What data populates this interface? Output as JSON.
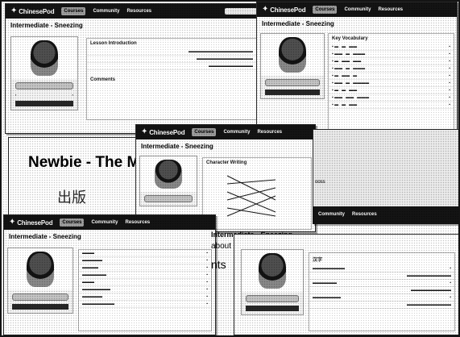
{
  "brand": "ChinesePod",
  "nav": {
    "items": [
      "Courses",
      "Community",
      "Resources"
    ],
    "selected": "Courses"
  },
  "lesson": {
    "title": "Intermediate - Sneezing",
    "title_fragment": "Intermediate - Sneezing"
  },
  "newbie": {
    "title": "Newbie - The Mea",
    "characters": "出版"
  },
  "panels": {
    "intro_heading": "Lesson Introduction",
    "comments_heading": "Comments",
    "key_vocab_heading": "Key Vocabulary",
    "writing_heading": "Character Writing"
  },
  "fragments": {
    "tab_text": "ooss",
    "about_text": "about",
    "ents_text": "nts",
    "vocab_ch": "汉字"
  },
  "icons": {
    "logo": "mascot-icon",
    "search": "search-icon"
  }
}
